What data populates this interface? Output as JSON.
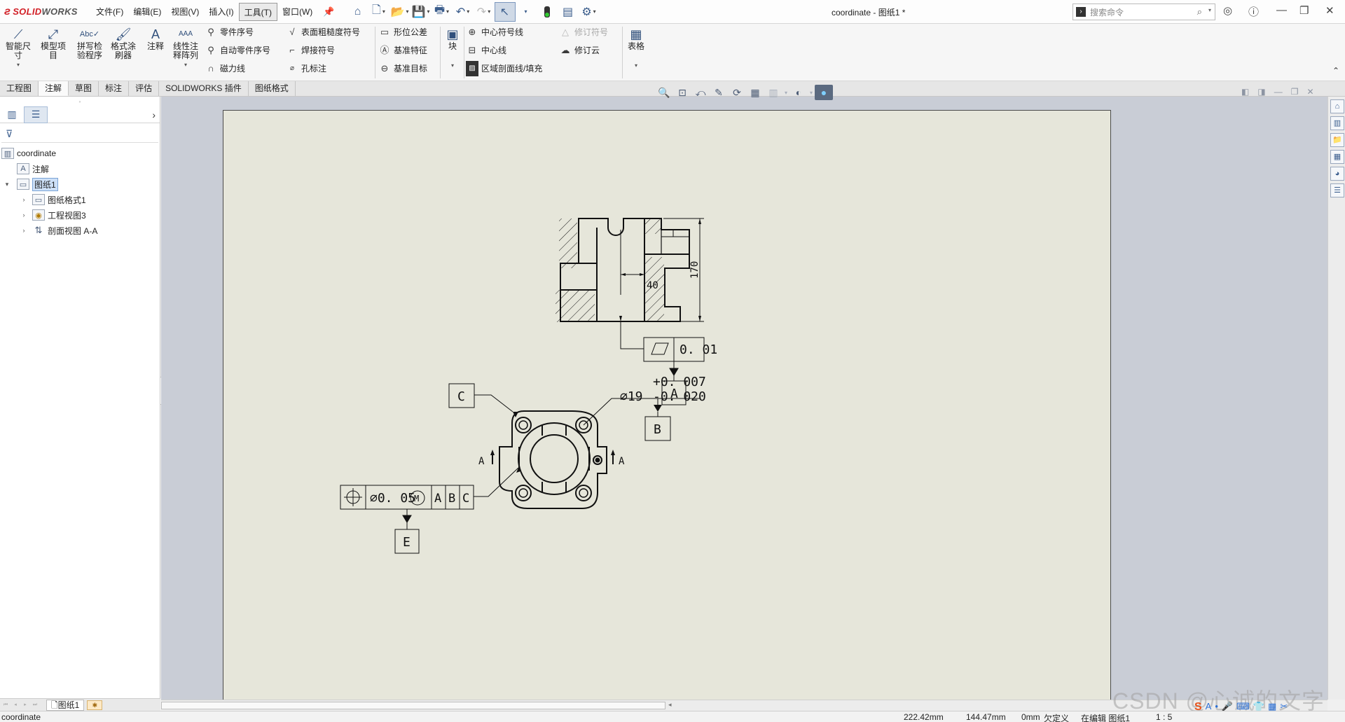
{
  "titlebar": {
    "logo_brand": "SOLIDWORKS",
    "logo_part1": "SOLID",
    "logo_part2": "WORKS",
    "menus": [
      "文件(F)",
      "编辑(E)",
      "视图(V)",
      "插入(I)",
      "工具(T)",
      "窗口(W)"
    ],
    "active_menu": "工具(T)",
    "document_title": "coordinate - 图纸1 *",
    "search_placeholder": "搜索命令"
  },
  "ribbon": {
    "smart_dimension": "智能尺寸",
    "model_items": "模型项目",
    "spell_checker": "拼写检验程序",
    "format_painter": "格式涂刷器",
    "note": "注释",
    "linear_note_pattern": "线性注释阵列",
    "balloon": "零件序号",
    "auto_balloon": "自动零件序号",
    "magnetic_line": "磁力线",
    "surface_finish": "表面粗糙度符号",
    "weld_symbol": "焊接符号",
    "hole_callout": "孔标注",
    "geometric_tolerance": "形位公差",
    "datum_feature": "基准特征",
    "datum_target": "基准目标",
    "block": "块",
    "center_mark": "中心符号线",
    "centerline": "中心线",
    "area_hatch": "区域剖面线/填充",
    "revision_symbol": "修订符号",
    "revision_cloud": "修订云",
    "table": "表格"
  },
  "tabs": [
    "工程图",
    "注解",
    "草图",
    "标注",
    "评估",
    "SOLIDWORKS 插件",
    "图纸格式"
  ],
  "active_tab": "注解",
  "feature_tree": {
    "root": "coordinate",
    "items": [
      {
        "label": "注解",
        "level": 1,
        "expandable": false
      },
      {
        "label": "图纸1",
        "level": 0,
        "expandable": true,
        "expanded": true,
        "selected": true
      },
      {
        "label": "图纸格式1",
        "level": 1,
        "expandable": true
      },
      {
        "label": "工程视图3",
        "level": 1,
        "expandable": true
      },
      {
        "label": "剖面视图 A-A",
        "level": 1,
        "expandable": true
      }
    ]
  },
  "sheet_tab": "图纸1",
  "drawing": {
    "dim_170": "170",
    "dim_40": "40",
    "flatness_value": "0. 01",
    "datum_a": "A",
    "datum_b": "B",
    "datum_c": "C",
    "datum_e": "E",
    "tol_upper": "+0. 007",
    "tol_lower": "-0. 020",
    "diameter_text": "∅19",
    "position_value": "∅0. 05",
    "position_modifier": "M",
    "section_label": "A"
  },
  "status": {
    "doc": "coordinate",
    "x": "222.42mm",
    "y": "144.47mm",
    "z": "0mm",
    "defined": "欠定义",
    "editing": "在编辑 图纸1",
    "scale": "1 : 5"
  },
  "watermark": "CSDN @心诚的文字"
}
